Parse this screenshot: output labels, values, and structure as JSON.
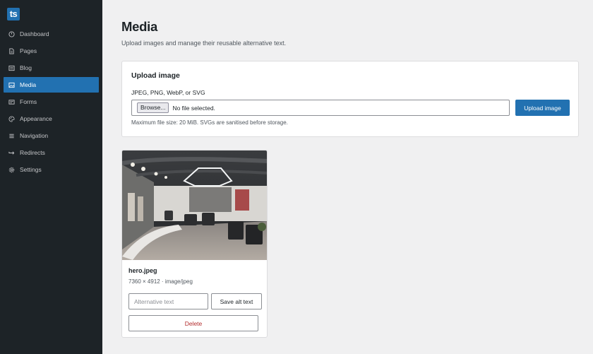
{
  "app": {
    "logo_text": "ts"
  },
  "sidebar": {
    "items": [
      {
        "label": "Dashboard",
        "icon": "dashboard-icon",
        "active": false
      },
      {
        "label": "Pages",
        "icon": "page-icon",
        "active": false
      },
      {
        "label": "Blog",
        "icon": "blog-icon",
        "active": false
      },
      {
        "label": "Media",
        "icon": "media-icon",
        "active": true
      },
      {
        "label": "Forms",
        "icon": "forms-icon",
        "active": false
      },
      {
        "label": "Appearance",
        "icon": "palette-icon",
        "active": false
      },
      {
        "label": "Navigation",
        "icon": "menu-icon",
        "active": false
      },
      {
        "label": "Redirects",
        "icon": "redirect-arrow-icon",
        "active": false
      },
      {
        "label": "Settings",
        "icon": "gear-icon",
        "active": false
      }
    ]
  },
  "page": {
    "title": "Media",
    "subtitle": "Upload images and manage their reusable alternative text."
  },
  "upload": {
    "title": "Upload image",
    "field_label": "JPEG, PNG, WebP, or SVG",
    "browse_label": "Browse...",
    "file_status": "No file selected.",
    "submit_label": "Upload image",
    "hint": "Maximum file size: 20 MiB. SVGs are sanitised before storage."
  },
  "media_items": [
    {
      "name": "hero.jpeg",
      "meta": "7360 × 4912 · image/jpeg",
      "alt_placeholder": "Alternative text",
      "save_label": "Save alt text",
      "delete_label": "Delete"
    }
  ],
  "colors": {
    "sidebar_bg": "#1d2327",
    "accent": "#2271b1",
    "danger": "#b32d2e",
    "page_bg": "#f0f0f1"
  }
}
